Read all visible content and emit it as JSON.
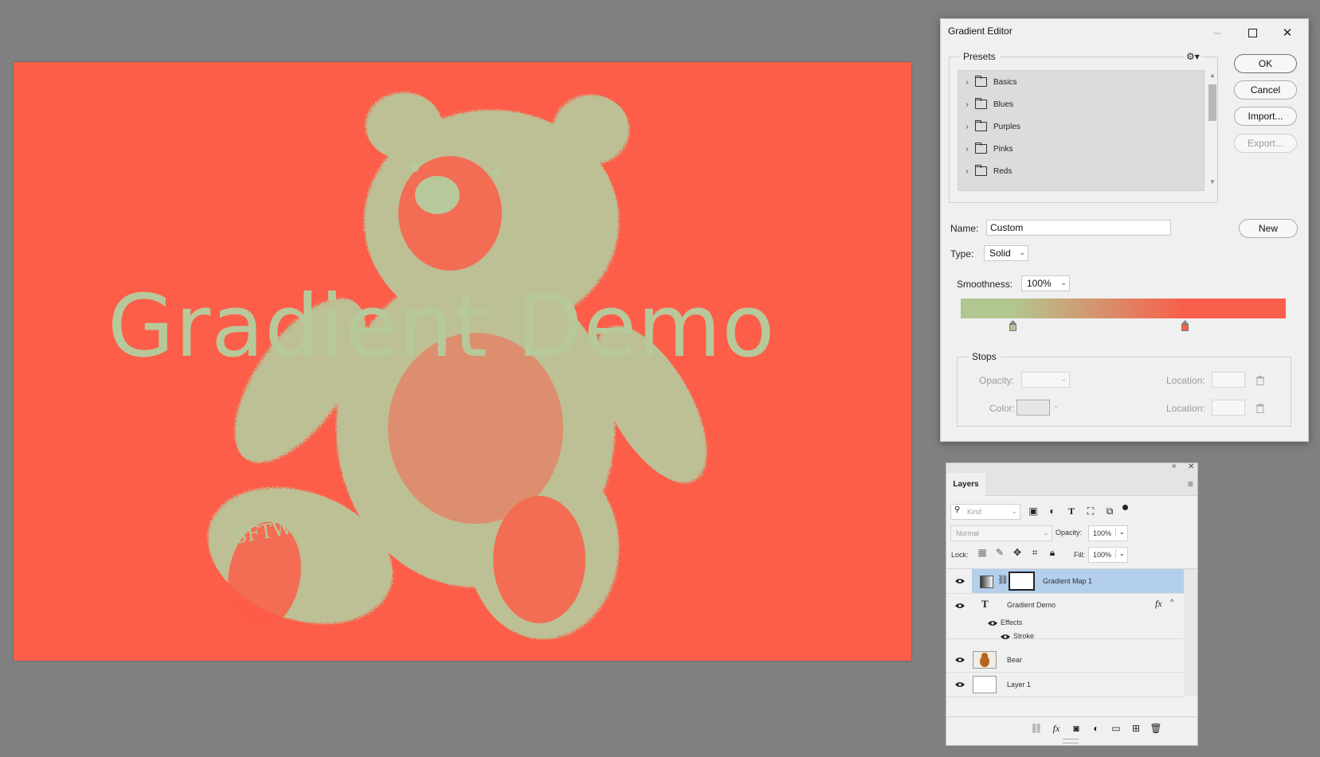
{
  "canvas": {
    "text": "Gradient Demo",
    "background_color": "#fd5e49",
    "mapped_color": "#b7c99b",
    "watermark": "SFTW"
  },
  "dialog": {
    "title": "Gradient Editor",
    "presets_label": "Presets",
    "presets": [
      "Basics",
      "Blues",
      "Purples",
      "Pinks",
      "Reds"
    ],
    "buttons": {
      "ok": "OK",
      "cancel": "Cancel",
      "import": "Import...",
      "export": "Export...",
      "new": "New"
    },
    "name_label": "Name:",
    "name_value": "Custom",
    "type_label": "Type:",
    "type_value": "Solid",
    "smoothness_label": "Smoothness:",
    "smoothness_value": "100%",
    "gradient": {
      "start_color": "#b2c690",
      "end_color": "#f95f4b",
      "stop_locations_percent": [
        16,
        69
      ]
    },
    "stops_label": "Stops",
    "opacity_label": "Opacity:",
    "color_label": "Color:",
    "location_label": "Location:"
  },
  "layers": {
    "tab": "Layers",
    "kind_placeholder": "Kind",
    "blend_mode": "Normal",
    "opacity_label": "Opacity:",
    "opacity_value": "100%",
    "lock_label": "Lock:",
    "fill_label": "Fill:",
    "fill_value": "100%",
    "items": [
      {
        "name": "Gradient Map 1"
      },
      {
        "name": "Gradient Demo",
        "effects_label": "Effects",
        "effect": "Stroke"
      },
      {
        "name": "Bear"
      },
      {
        "name": "Layer 1"
      }
    ]
  }
}
